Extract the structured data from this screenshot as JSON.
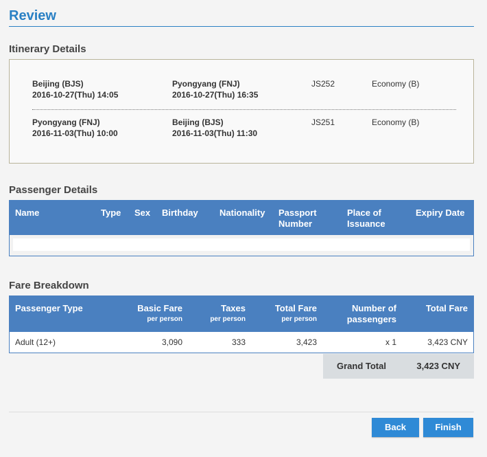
{
  "review": {
    "title": "Review"
  },
  "itinerary": {
    "heading": "Itinerary Details",
    "segments": [
      {
        "from_city": "Beijing (BJS)",
        "from_time": "2016-10-27(Thu) 14:05",
        "to_city": "Pyongyang (FNJ)",
        "to_time": "2016-10-27(Thu) 16:35",
        "flight": "JS252",
        "cabin": "Economy (B)"
      },
      {
        "from_city": "Pyongyang (FNJ)",
        "from_time": "2016-11-03(Thu) 10:00",
        "to_city": "Beijing (BJS)",
        "to_time": "2016-11-03(Thu) 11:30",
        "flight": "JS251",
        "cabin": "Economy (B)"
      }
    ]
  },
  "passenger": {
    "heading": "Passenger Details",
    "columns": {
      "name": "Name",
      "type": "Type",
      "sex": "Sex",
      "birthday": "Birthday",
      "nationality": "Nationality",
      "passport_1": "Passport",
      "passport_2": "Number",
      "place_1": "Place of",
      "place_2": "Issuance",
      "expiry": "Expiry Date"
    }
  },
  "fare": {
    "heading": "Fare Breakdown",
    "columns": {
      "ptype": "Passenger Type",
      "basic": "Basic Fare",
      "basic_sub": "per person",
      "taxes": "Taxes",
      "taxes_sub": "per person",
      "total": "Total Fare",
      "total_sub": "per person",
      "num_1": "Number of",
      "num_2": "passengers",
      "total_fare": "Total Fare"
    },
    "row": {
      "ptype": "Adult (12+)",
      "basic": "3,090",
      "taxes": "333",
      "total": "3,423",
      "count": "x 1",
      "total_fare": "3,423 CNY"
    }
  },
  "grand_total": {
    "label": "Grand Total",
    "value": "3,423 CNY"
  },
  "buttons": {
    "back": "Back",
    "finish": "Finish"
  },
  "colors": {
    "accent": "#2a80c4",
    "table_header": "#4a80c0",
    "button": "#2f8ad6"
  }
}
